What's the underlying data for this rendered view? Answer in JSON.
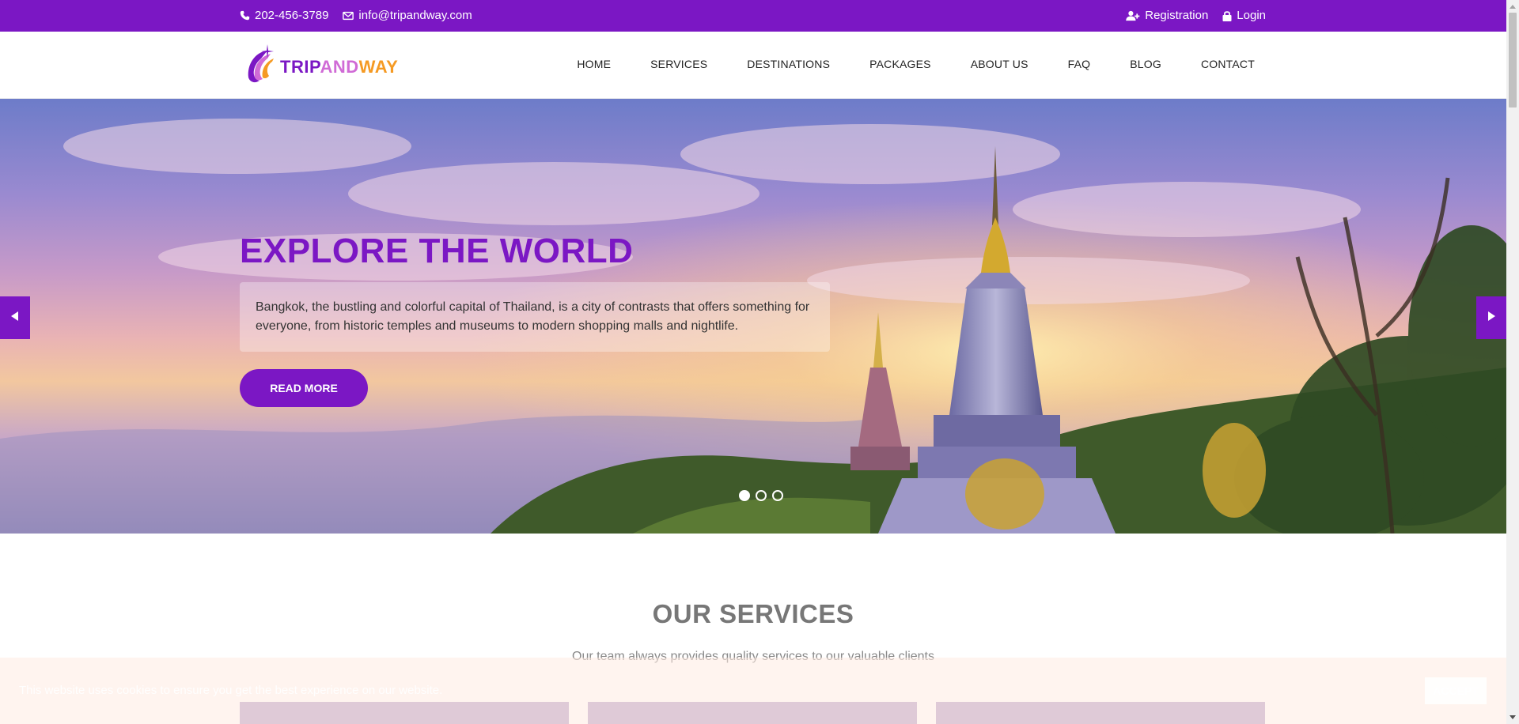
{
  "topbar": {
    "phone": "202-456-3789",
    "email": "info@tripandway.com",
    "registration": "Registration",
    "login": "Login"
  },
  "logo": {
    "part1": "TRIP",
    "part2": "AND",
    "part3": "WAY"
  },
  "nav": {
    "items": [
      "HOME",
      "SERVICES",
      "DESTINATIONS",
      "PACKAGES",
      "ABOUT US",
      "FAQ",
      "BLOG",
      "CONTACT"
    ]
  },
  "hero": {
    "title": "EXPLORE THE WORLD",
    "description": "Bangkok, the bustling and colorful capital of Thailand, is a city of contrasts that offers something for everyone, from historic temples and museums to modern shopping malls and nightlife.",
    "button": "READ MORE",
    "slides_total": 3,
    "active_slide": 1
  },
  "services": {
    "title": "OUR SERVICES",
    "subtitle": "Our team always provides quality services to our valuable clients"
  },
  "cookie": {
    "text": "This website uses cookies to ensure you get the best experience on our website.",
    "button": "ACCEPT"
  },
  "colors": {
    "brand": "#7b17c4",
    "accent_orange": "#f59a23",
    "accent_pink": "#d06bd6"
  }
}
